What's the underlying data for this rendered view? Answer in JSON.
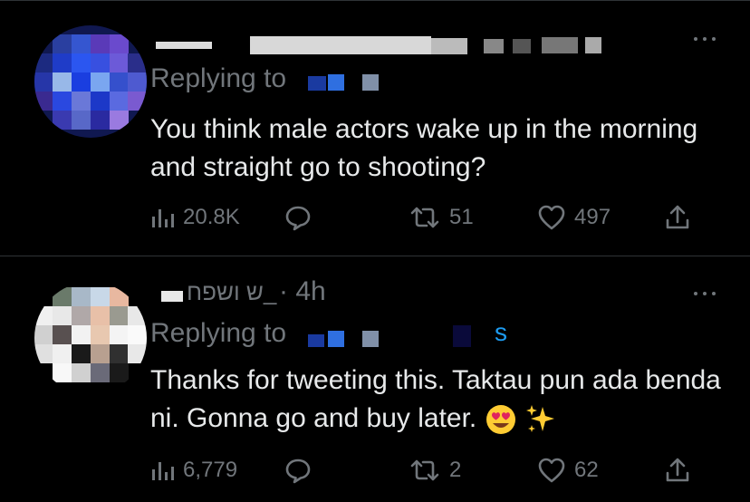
{
  "tweets": [
    {
      "reply_prefix": "Replying to",
      "text": "You think male actors wake up in the morning and straight go to shooting?",
      "icons": {
        "views": "bar-chart-icon",
        "reply": "speech-bubble-icon",
        "retweet": "retweet-icon",
        "like": "heart-icon",
        "share": "share-upload-icon",
        "more": "more-dots-icon"
      },
      "stats": {
        "views": "20.8K",
        "retweets": "51",
        "likes": "497"
      }
    },
    {
      "handle_fragment": "ש ושפח_",
      "time": "· 4h",
      "reply_prefix": "Replying to",
      "reply_tail": "s",
      "text": "Thanks for tweeting this. Taktau pun ada benda ni. Gonna go and buy later.",
      "emojis": [
        "heart-eyes-emoji",
        "sparkles-emoji"
      ],
      "icons": {
        "views": "bar-chart-icon",
        "reply": "speech-bubble-icon",
        "retweet": "retweet-icon",
        "like": "heart-icon",
        "share": "share-upload-icon",
        "more": "more-dots-icon"
      },
      "stats": {
        "views": "6,779",
        "retweets": "2",
        "likes": "62"
      }
    }
  ],
  "colors": {
    "background": "#000000",
    "text": "#e7e9ea",
    "muted": "#71767b",
    "divider": "#2f3336",
    "accent_blue": "#1d9bf0"
  }
}
